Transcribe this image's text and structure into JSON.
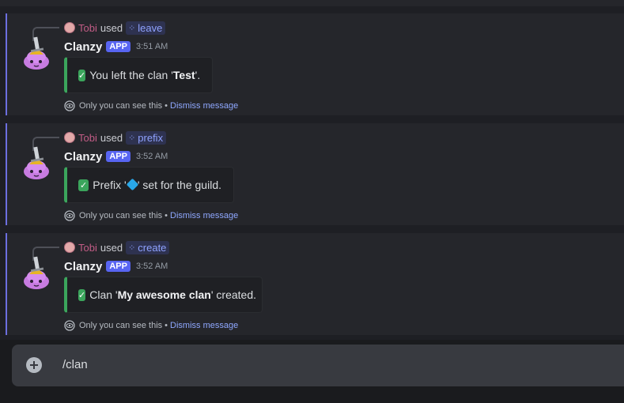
{
  "messages": [
    {
      "reply_user": "Tobi",
      "reply_used": "used",
      "command": "leave",
      "bot_name": "Clanzy",
      "badge": "APP",
      "time": "3:51 AM",
      "embed": {
        "prefix": "You left the clan '",
        "bold": "Test",
        "suffix": "'."
      },
      "ephemeral_text": "Only you can see this",
      "dot": "•",
      "dismiss": "Dismiss message"
    },
    {
      "reply_user": "Tobi",
      "reply_used": "used",
      "command": "prefix",
      "bot_name": "Clanzy",
      "badge": "APP",
      "time": "3:52 AM",
      "embed": {
        "prefix": "Prefix '",
        "emoji": "diamond-with-dot-emoji",
        "suffix": "' set for the guild."
      },
      "ephemeral_text": "Only you can see this",
      "dot": "•",
      "dismiss": "Dismiss message"
    },
    {
      "reply_user": "Tobi",
      "reply_used": "used",
      "command": "create",
      "bot_name": "Clanzy",
      "badge": "APP",
      "time": "3:52 AM",
      "embed": {
        "prefix": "Clan '",
        "bold": "My awesome clan",
        "suffix": "' created."
      },
      "ephemeral_text": "Only you can see this",
      "dot": "•",
      "dismiss": "Dismiss message"
    }
  ],
  "composer": {
    "value": "/clan"
  },
  "colors": {
    "accent": "#5865f2",
    "success": "#3ba55c",
    "reply_user": "#c25c86",
    "link": "#8fa8ff",
    "mention_line": "#6c6fe0"
  },
  "icons": {
    "check": "white-check-mark-icon",
    "eye": "eye-icon",
    "plus": "plus-circle-icon",
    "command": "slash-command-icon"
  }
}
